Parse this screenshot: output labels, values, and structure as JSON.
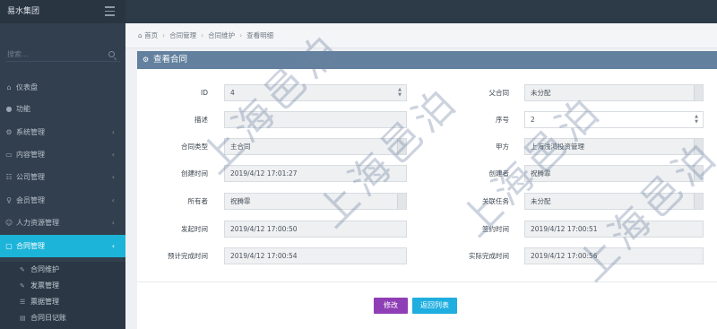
{
  "brand": "易水集团",
  "sidebar": {
    "search_placeholder": "搜索...",
    "items": [
      {
        "label": "仪表盘",
        "icon": "home-icon"
      },
      {
        "label": "功能",
        "icon": "circle-icon"
      },
      {
        "label": "系统管理",
        "icon": "gears-icon"
      },
      {
        "label": "内容管理",
        "icon": "folder-icon"
      },
      {
        "label": "公司管理",
        "icon": "sitemap-icon"
      },
      {
        "label": "会员管理",
        "icon": "user-icon"
      },
      {
        "label": "人力资源管理",
        "icon": "users-icon"
      },
      {
        "label": "合同管理",
        "icon": "file-icon"
      }
    ],
    "sub_items": [
      {
        "label": "合同维护",
        "icon": "edit-icon"
      },
      {
        "label": "发票管理",
        "icon": "edit-icon"
      },
      {
        "label": "票据管理",
        "icon": "list-icon"
      },
      {
        "label": "合同日记账",
        "icon": "book-icon"
      }
    ]
  },
  "breadcrumb": [
    "首页",
    "合同管理",
    "合同维护",
    "查看明细"
  ],
  "panel": {
    "title": "查看合同"
  },
  "form": {
    "id_label": "ID",
    "id_value": "4",
    "parent_label": "父合同",
    "parent_value": "未分配",
    "desc_label": "描述",
    "desc_value": "",
    "seq_label": "序号",
    "seq_value": "2",
    "type_label": "合同类型",
    "type_value": "主合同",
    "party_a_label": "甲方",
    "party_a_value": "上海浅鸿投资管理",
    "created_time_label": "创建时间",
    "created_time_value": "2019/4/12 17:01:27",
    "creator_label": "创建者",
    "creator_value": "祝腾霏",
    "owner_label": "所有者",
    "owner_value": "祝腾霏",
    "task_label": "关联任务",
    "task_value": "未分配",
    "issue_time_label": "发起时间",
    "issue_time_value": "2019/4/12 17:00:50",
    "sign_time_label": "签约时间",
    "sign_time_value": "2019/4/12 17:00:51",
    "plan_done_label": "预计完成时间",
    "plan_done_value": "2019/4/12 17:00:54",
    "actual_done_label": "实际完成时间",
    "actual_done_value": "2019/4/12 17:00:56"
  },
  "buttons": {
    "edit": "修改",
    "back": "返回列表"
  },
  "watermark": "上海邑泊"
}
